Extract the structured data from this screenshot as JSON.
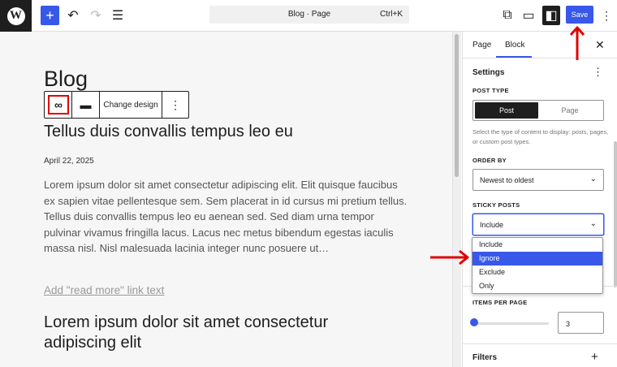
{
  "header": {
    "logo_letter": "W",
    "add_icon": "plus-icon",
    "undo_icon": "undo-icon",
    "redo_icon": "redo-icon",
    "list_view_icon": "list-view-icon",
    "command_title": "Blog · Page",
    "command_shortcut": "Ctrl+K",
    "view_icon": "external-link-icon",
    "device_icon": "desktop-icon",
    "settings_icon": "sidebar-toggle-icon",
    "save_label": "Save",
    "more_icon": "vertical-dots-icon"
  },
  "canvas": {
    "page_title": "Blog",
    "toolbar": {
      "link_icon": "link-icon",
      "align_icon": "align-icon",
      "change_design": "Change design",
      "more_icon": "vertical-dots-icon"
    },
    "post_title": "Tellus duis convallis tempus leo eu",
    "post_date": "April 22, 2025",
    "excerpt": "Lorem ipsum dolor sit amet consectetur adipiscing elit. Elit quisque faucibus ex sapien vitae pellentesque sem. Sem placerat in id cursus mi pretium tellus. Tellus duis convallis tempus leo eu aenean sed. Sed diam urna tempor pulvinar vivamus fringilla lacus. Lacus nec metus bibendum egestas iaculis massa nisl. Nisl malesuada lacinia integer nunc posuere ut…",
    "read_more": "Add \"read more\" link text",
    "post_title_2": "Lorem ipsum dolor sit amet consectetur adipiscing elit"
  },
  "sidebar": {
    "tabs": [
      "Page",
      "Block"
    ],
    "active_tab": "Block",
    "settings_title": "Settings",
    "post_type_label": "POST TYPE",
    "post_type_options": [
      "Post",
      "Page"
    ],
    "post_type_selected": "Post",
    "post_type_help": "Select the type of content to display: posts, pages, or custom post types.",
    "order_by_label": "ORDER BY",
    "order_by_value": "Newest to oldest",
    "sticky_label": "STICKY POSTS",
    "sticky_value": "Include",
    "sticky_options": [
      "Include",
      "Ignore",
      "Exclude",
      "Only"
    ],
    "sticky_highlighted": "Ignore",
    "items_per_page_label": "ITEMS PER PAGE",
    "items_per_page_value": "3",
    "filters_label": "Filters"
  },
  "colors": {
    "accent": "#3858e9",
    "annotation": "#e00000"
  }
}
